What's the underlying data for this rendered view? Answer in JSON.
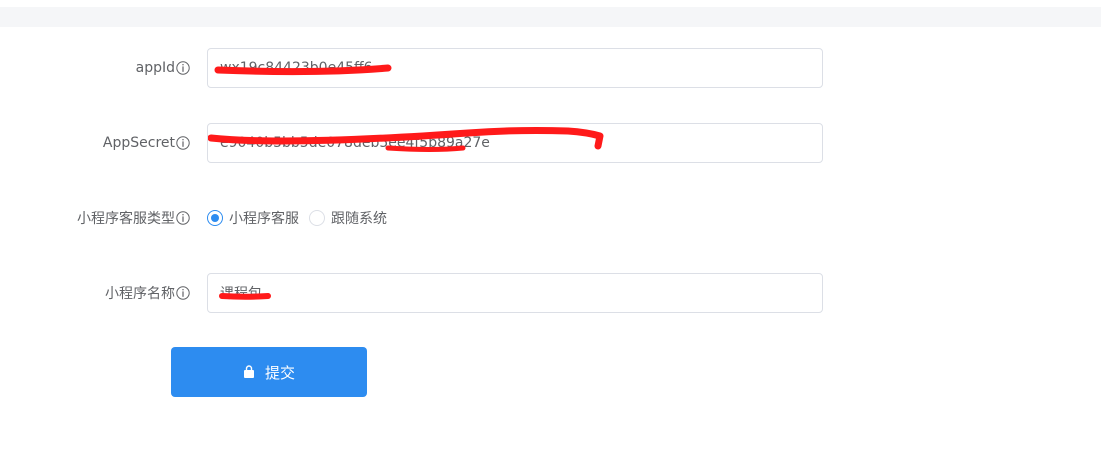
{
  "form": {
    "appid": {
      "label": "appId",
      "value": "wx19c84423b0e45ff6"
    },
    "appsecret": {
      "label": "AppSecret",
      "value": "e9040b5bb5de078deb5ee4f5b89a27e"
    },
    "service_type": {
      "label": "小程序客服类型",
      "options": [
        "小程序客服",
        "跟随系统"
      ],
      "selected": "小程序客服"
    },
    "mini_name": {
      "label": "小程序名称",
      "value": "课程包"
    }
  },
  "submit": {
    "label": "提交"
  },
  "colors": {
    "primary": "#2d8cf0",
    "redaction": "#ff1a1a",
    "border": "#dcdfe6",
    "text": "#606266"
  },
  "icons": [
    "info-circle-icon",
    "lock-icon"
  ]
}
